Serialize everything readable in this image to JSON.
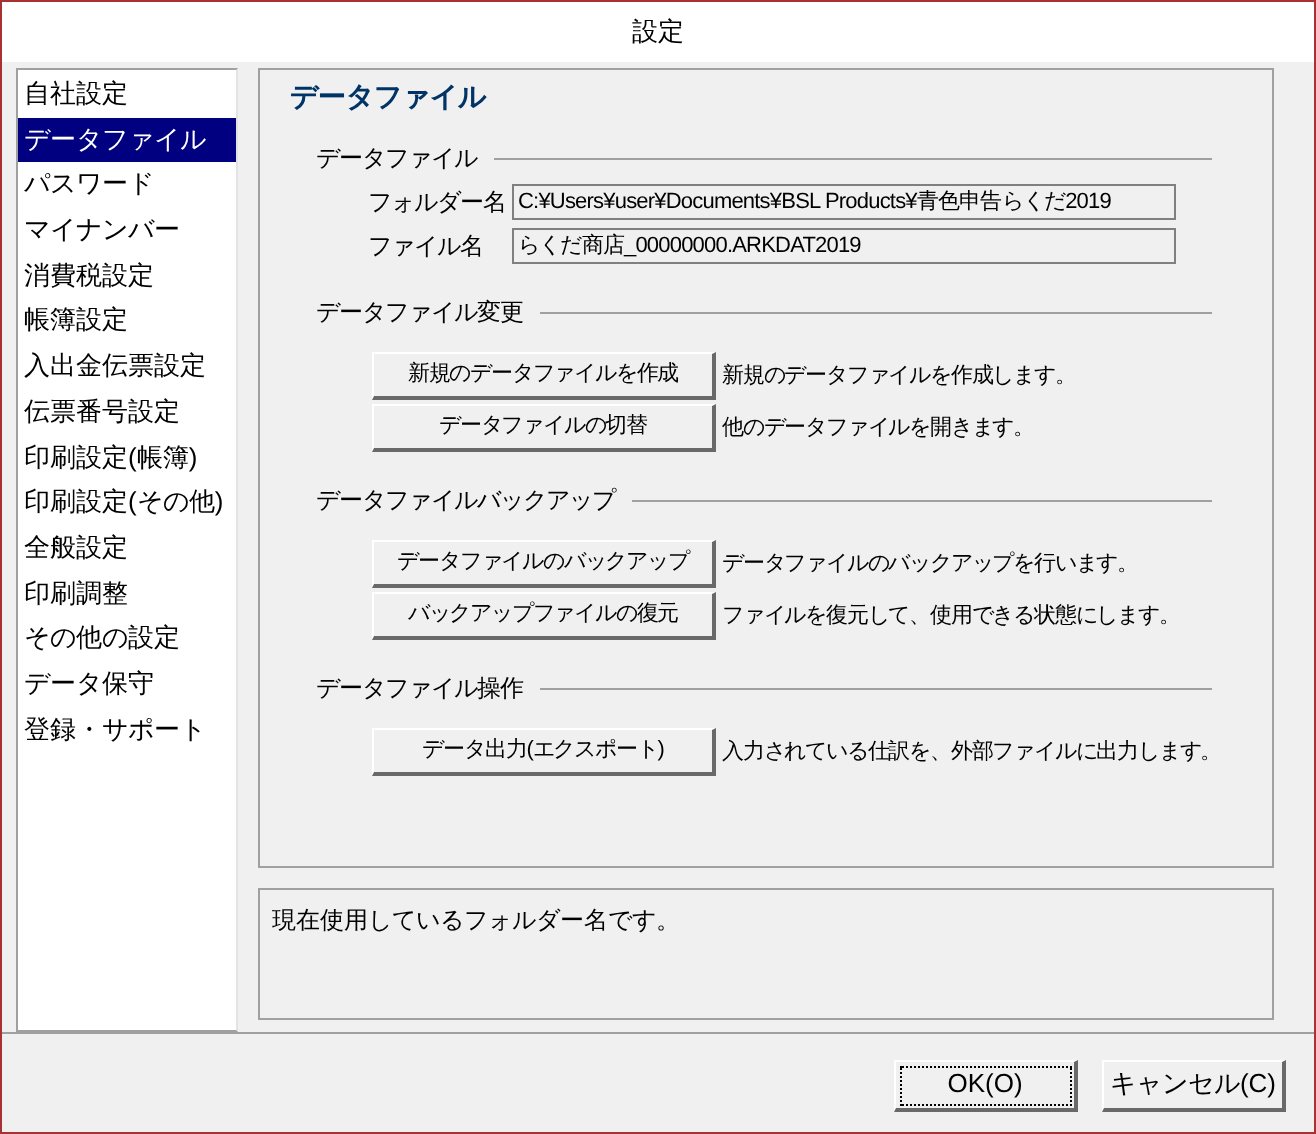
{
  "window": {
    "title": "設定"
  },
  "sidebar": {
    "items": [
      {
        "label": "自社設定",
        "selected": false
      },
      {
        "label": "データファイル",
        "selected": true
      },
      {
        "label": "パスワード",
        "selected": false
      },
      {
        "label": "マイナンバー",
        "selected": false
      },
      {
        "label": "消費税設定",
        "selected": false
      },
      {
        "label": "帳簿設定",
        "selected": false
      },
      {
        "label": "入出金伝票設定",
        "selected": false
      },
      {
        "label": "伝票番号設定",
        "selected": false
      },
      {
        "label": "印刷設定(帳簿)",
        "selected": false
      },
      {
        "label": "印刷設定(その他)",
        "selected": false
      },
      {
        "label": "全般設定",
        "selected": false
      },
      {
        "label": "印刷調整",
        "selected": false
      },
      {
        "label": "その他の設定",
        "selected": false
      },
      {
        "label": "データ保守",
        "selected": false
      },
      {
        "label": "登録・サポート",
        "selected": false
      }
    ]
  },
  "panel": {
    "title": "データファイル",
    "sections": [
      {
        "kind": "fields",
        "title": "データファイル",
        "rows": [
          {
            "label": "フォルダー名",
            "value": "C:¥Users¥user¥Documents¥BSL Products¥青色申告らくだ2019"
          },
          {
            "label": "ファイル名",
            "value": "らくだ商店_00000000.ARKDAT2019"
          }
        ]
      },
      {
        "kind": "actions",
        "title": "データファイル変更",
        "rows": [
          {
            "button": "新規のデータファイルを作成",
            "description": "新規のデータファイルを作成します。"
          },
          {
            "button": "データファイルの切替",
            "description": "他のデータファイルを開きます。"
          }
        ]
      },
      {
        "kind": "actions",
        "title": "データファイルバックアップ",
        "rows": [
          {
            "button": "データファイルのバックアップ",
            "description": "データファイルのバックアップを行います。"
          },
          {
            "button": "バックアップファイルの復元",
            "description": "ファイルを復元して、使用できる状態にします。"
          }
        ]
      },
      {
        "kind": "actions",
        "title": "データファイル操作",
        "rows": [
          {
            "button": "データ出力(エクスポート)",
            "description": "入力されている仕訳を、外部ファイルに出力します。"
          }
        ]
      }
    ]
  },
  "help_text": "現在使用しているフォルダー名です。",
  "buttons": [
    {
      "label": "OK(O)",
      "focused": true
    },
    {
      "label": "キャンセル(C)",
      "focused": false
    }
  ]
}
